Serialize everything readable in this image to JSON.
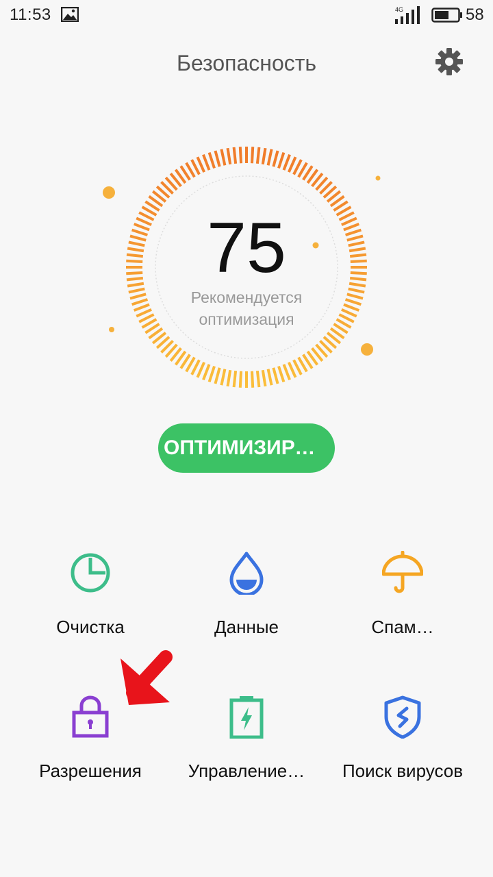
{
  "status_bar": {
    "time": "11:53",
    "network": "4G",
    "battery_level": "58"
  },
  "header": {
    "title": "Безопасность",
    "settings_icon": "gear-icon"
  },
  "score": {
    "value": "75",
    "caption_line1": "Рекомендуется",
    "caption_line2": "оптимизация",
    "ring_color_top": "#f07a2a",
    "ring_color_bottom": "#fbbf3a"
  },
  "optimize_button": {
    "label": "ОПТИМИЗИРО…",
    "color": "#3cc265"
  },
  "tiles": [
    {
      "label": "Очистка",
      "icon": "pie-chart-icon",
      "color": "#3dbd8a"
    },
    {
      "label": "Данные",
      "icon": "water-drop-icon",
      "color": "#3a72e0"
    },
    {
      "label": "Спам…",
      "icon": "umbrella-icon",
      "color": "#f5a623"
    },
    {
      "label": "Разрешения",
      "icon": "lock-icon",
      "color": "#8a3fd1"
    },
    {
      "label": "Управление…",
      "icon": "battery-charge-icon",
      "color": "#3dbd8a"
    },
    {
      "label": "Поиск вирусов",
      "icon": "shield-icon",
      "color": "#3a72e0"
    }
  ],
  "annotation": {
    "color": "#e8141b",
    "icon": "arrow-down-left-icon"
  }
}
